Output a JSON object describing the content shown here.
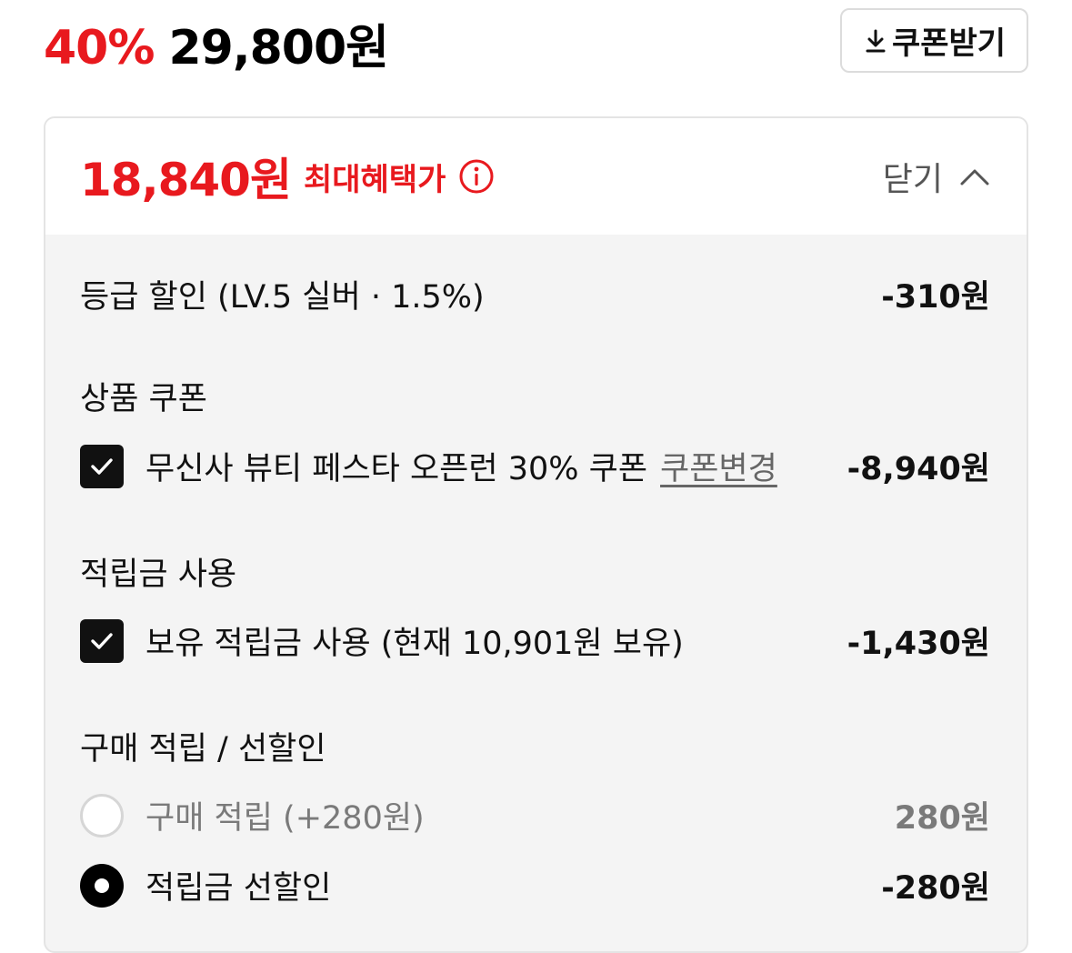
{
  "price": {
    "discount_rate": "40%",
    "sale_price": "29,800원"
  },
  "coupon_button": {
    "label": "쿠폰받기",
    "icon": "download-icon"
  },
  "benefit": {
    "max_price": "18,840원",
    "max_label": "최대혜택가",
    "info_icon": "info-icon",
    "close_label": "닫기",
    "close_icon": "chevron-up-icon"
  },
  "grade_discount": {
    "label": "등급 할인 (LV.5 실버 · 1.5%)",
    "amount": "-310원"
  },
  "product_coupon": {
    "title": "상품 쿠폰",
    "item_label": "무신사 뷰티 페스타 오픈런 30% 쿠폰",
    "change_link": "쿠폰변경",
    "amount": "-8,940원",
    "checked": true
  },
  "points_use": {
    "title": "적립금 사용",
    "item_label": "보유 적립금 사용 (현재 10,901원 보유)",
    "amount": "-1,430원",
    "checked": true
  },
  "purchase_points": {
    "title": "구매 적립 / 선할인",
    "options": [
      {
        "label": "구매 적립 (+280원)",
        "amount": "280원",
        "selected": false
      },
      {
        "label": "적립금 선할인",
        "amount": "-280원",
        "selected": true
      }
    ]
  },
  "colors": {
    "accent_red": "#e8191e",
    "panel_bg": "#f4f4f4",
    "border": "#e4e4e4"
  }
}
